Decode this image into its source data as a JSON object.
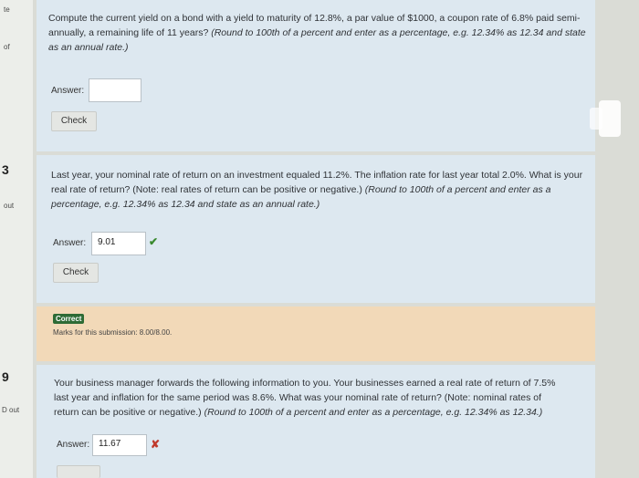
{
  "sidebar": {
    "frag1": "te",
    "frag2": "of",
    "frag3": "3",
    "frag4": "out",
    "frag5": "9",
    "frag6": "D out"
  },
  "q1": {
    "text_main": "Compute the current yield on a bond with a yield to maturity of 12.8%, a par value of $1000, a coupon rate of 6.8% paid semi-annually, a remaining life of 11 years? ",
    "text_instr": "(Round to 100th of a percent and enter as a percentage, e.g. 12.34% as 12.34 and state as an annual rate.)",
    "answer_label": "Answer:",
    "answer_value": "",
    "check_label": "Check"
  },
  "q2": {
    "text_main": "Last year, your nominal rate of return on an investment equaled 11.2%. The inflation rate for last year total 2.0%. What is your real rate of return? (Note: real rates of return can be positive or negative.) ",
    "text_instr": "(Round to 100th of a percent and enter as a percentage, e.g. 12.34% as 12.34 and state as an annual rate.)",
    "answer_label": "Answer:",
    "answer_value": "9.01",
    "check_label": "Check",
    "mark_icon": "check-icon",
    "feedback_badge": "Correct",
    "feedback_marks": "Marks for this submission: 8.00/8.00."
  },
  "q3": {
    "text_main": "Your business manager forwards the following information to you. Your businesses earned a real rate of return of 7.5% last year and inflation for the same period was 8.6%. What was your nominal rate of return? (Note: nominal rates of return can be positive or negative.) ",
    "text_instr": "(Round to 100th of a percent and enter as a percentage, e.g. 12.34% as 12.34.)",
    "answer_label": "Answer:",
    "answer_value": "11.67",
    "mark_icon": "cross-icon"
  },
  "colors": {
    "question_bg": "#dde8f0",
    "feedback_bg": "#f2d9b8",
    "correct_badge": "#2e6b35",
    "check_green": "#3a8a2f",
    "cross_red": "#c0392b"
  }
}
